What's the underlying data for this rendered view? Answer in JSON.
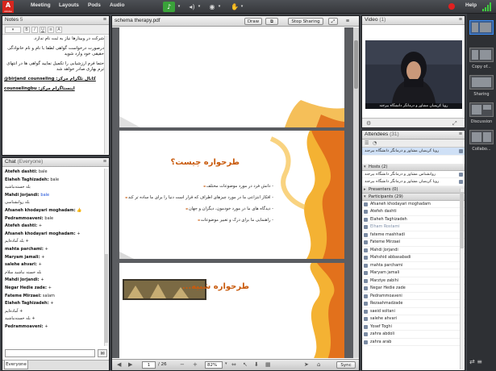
{
  "topbar": {
    "logo_main": "A",
    "logo_sub": "Adobe",
    "menus": [
      "Meeting",
      "Layouts",
      "Pods",
      "Audio"
    ],
    "help": "Help"
  },
  "notes": {
    "title": "Notes",
    "count": "5",
    "lines": [
      "شرکت در وبینارها نیاز به ثبت نام ندارد.",
      "درصورت درخواست گواهی لطفا با نام و نام خانوادگی حقیقی خود وارد شوید",
      "حتما فرم ارزشیابی را تکمیل نمایید گواهی ها در انتهای ترم بهاری صادر خواهد شد"
    ],
    "links": [
      "@birjand_counseling :کانال تلگرام مرکز",
      "counselingbu :اینستاگرام مرکز"
    ]
  },
  "chat": {
    "title": "Chat",
    "audience": "(Everyone)",
    "tab": "Everyone",
    "send_icon": "speech-bubble-icon",
    "messages": [
      {
        "user": "Atefeh dashti",
        "text": "bale"
      },
      {
        "user": "Elaheh Taghizadeh",
        "text": "bale"
      },
      {
        "user": "",
        "text": "بله خسته‌نباشید",
        "rtl": true
      },
      {
        "user": "Mahdi Jorjandi",
        "text": "bale",
        "blue": true
      },
      {
        "user": "",
        "text": "بله روانشناسی",
        "rtl": true
      },
      {
        "user": "Afsaneh khodayari moghadam",
        "text": "👍"
      },
      {
        "user": "Pedrammoaveni",
        "text": "bale"
      },
      {
        "user": "Atefeh dashti",
        "text": "+"
      },
      {
        "user": "Afsaneh khodayari moghadam",
        "text": "+"
      },
      {
        "user": "",
        "text": "+ بله آماده‌ایم",
        "rtl": true
      },
      {
        "user": "mahta parchami",
        "text": "+"
      },
      {
        "user": "Maryam jamali",
        "text": "+"
      },
      {
        "user": "salehe ahvari",
        "text": "+"
      },
      {
        "user": "",
        "text": "بله خسته نباشید سلام",
        "rtl": true
      },
      {
        "user": "Mahdi Jorjandi",
        "text": "+"
      },
      {
        "user": "Negar Hedie zade",
        "text": "+"
      },
      {
        "user": "Fateme Mirzaei",
        "text": "salam"
      },
      {
        "user": "Elaheh Taghizadeh",
        "text": "+"
      },
      {
        "user": "",
        "text": "+ آماده‌ایم",
        "rtl": true
      },
      {
        "user": "",
        "text": "+ بله خسته‌نباشید",
        "rtl": true
      },
      {
        "user": "Pedrammoaveni",
        "text": "+"
      }
    ]
  },
  "share": {
    "title": "schema therapy.pdf",
    "draw": "Draw",
    "stop": "Stop Sharing",
    "page": "1",
    "total": "/ 26",
    "zoom": "82%",
    "sync": "Sync",
    "slide1": {
      "title": "طرحواره چیست؟",
      "bullets": [
        "- دانش فرد در مورد موضوعات مختلف",
        "- افکار انتزاعی ما در مورد چیزهای اطراف که قرار است دنیا را برای ما ساده تر کند",
        "- دیدگاه های ما در مورد خودمون، دیگران و جهان",
        "- راهنمایی ما برای درک و تعبیر موضوعات"
      ]
    },
    "slide2": {
      "title": "طرحواره شبیه..."
    }
  },
  "video": {
    "title": "Video",
    "count": "(1)",
    "caption": "رویا کریمیان مشاور و درمانگر دانشگاه بیرجند"
  },
  "attendees": {
    "title": "Attendees",
    "count": "(31)",
    "presenter_line": "رویا کریمیان مشاور و درمانگر دانشگاه بیرجند",
    "hosts_label": "Hosts (2)",
    "hosts": [
      "روانشناس مشاور و درمانگر دانشگاه بیرجند",
      "رویا کریمیان مشاور و درمانگر دانشگاه بیرجند"
    ],
    "presenters_label": "Presenters (0)",
    "participants_label": "Participants (29)",
    "participants": [
      "Afsaneh khodayari moghadam",
      "Atefeh dashti",
      "Elaheh Taghizadeh",
      "Elham Rostami",
      "fateme mashhadi",
      "Fateme Mirzaei",
      "Mahdi Jorjandi",
      "Mahshid abbasabadi",
      "mahta parchami",
      "Maryam jamali",
      "Marziye zabihi",
      "Negar Hedie zade",
      "Pedrammoaveni",
      "Rezaahmadzade",
      "saeid soltani",
      "salehe ahvari",
      "Yosef Toghi",
      "zahra abdoli",
      "zahra arab"
    ]
  },
  "layouts": {
    "items": [
      "",
      "Copy of...",
      "Sharing",
      "Discussion",
      "Collabo..."
    ]
  }
}
